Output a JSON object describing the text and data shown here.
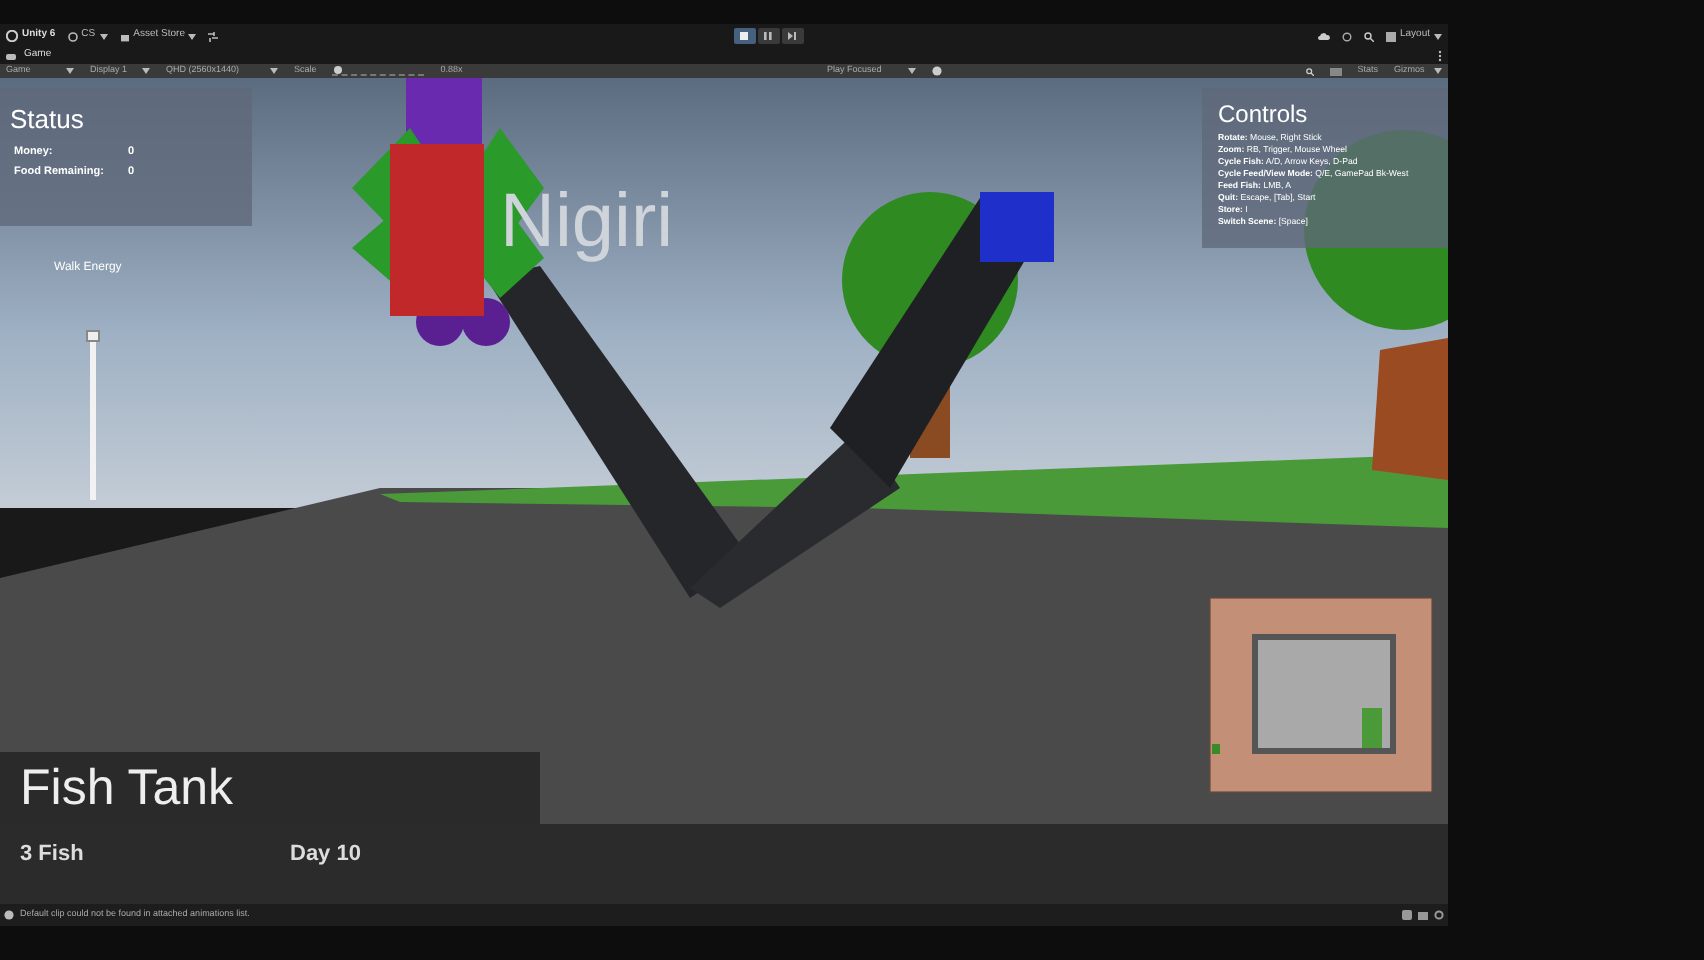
{
  "toolbar": {
    "account": "Unity 6",
    "cloud_menu": "CS",
    "asset_store": "Asset Store",
    "layout": "Layout",
    "play_buttons": [
      {
        "kind": "play",
        "selected": true
      },
      {
        "kind": "pause",
        "selected": false
      },
      {
        "kind": "step",
        "selected": false
      }
    ]
  },
  "tabs": [
    {
      "label": "Game",
      "selected": true
    }
  ],
  "game_bar": {
    "mode": "Game",
    "display": "Display 1",
    "resolution": "QHD (2560x1440)",
    "scale": {
      "label": "Scale",
      "level": 0.02,
      "reading": "0.88x"
    },
    "play_mode": "Play Focused",
    "stats": "Stats",
    "gizmos": "Gizmos"
  },
  "hud": {
    "status": {
      "title": "Status",
      "rows": [
        {
          "label": "Money:",
          "value": "0"
        },
        {
          "label": "Food Remaining:",
          "value": "0"
        }
      ]
    },
    "walk_energy": {
      "label": "Walk Energy",
      "level": 1
    },
    "scene_text": "Nigiri",
    "controls": {
      "title": "Controls",
      "lines": [
        "**Rotate:** Mouse, Right Stick",
        "**Zoom:** RB, Trigger, Mouse Wheel",
        "**Cycle Fish:** A/D, Arrow Keys, D-Pad",
        "**Cycle Feed/View Mode:** Q/E, GamePad Bk-West",
        "**Feed Fish:** LMB, A",
        "**Quit:** Escape, [Tab], Start",
        "**Store:** I",
        "**Switch Scene:** [Space]"
      ]
    },
    "tank": {
      "title": "Fish Tank",
      "fish_count": "3 Fish",
      "day": "Day 10"
    }
  },
  "status_bar": {
    "message": "Default clip could not be found in attached animations list."
  }
}
